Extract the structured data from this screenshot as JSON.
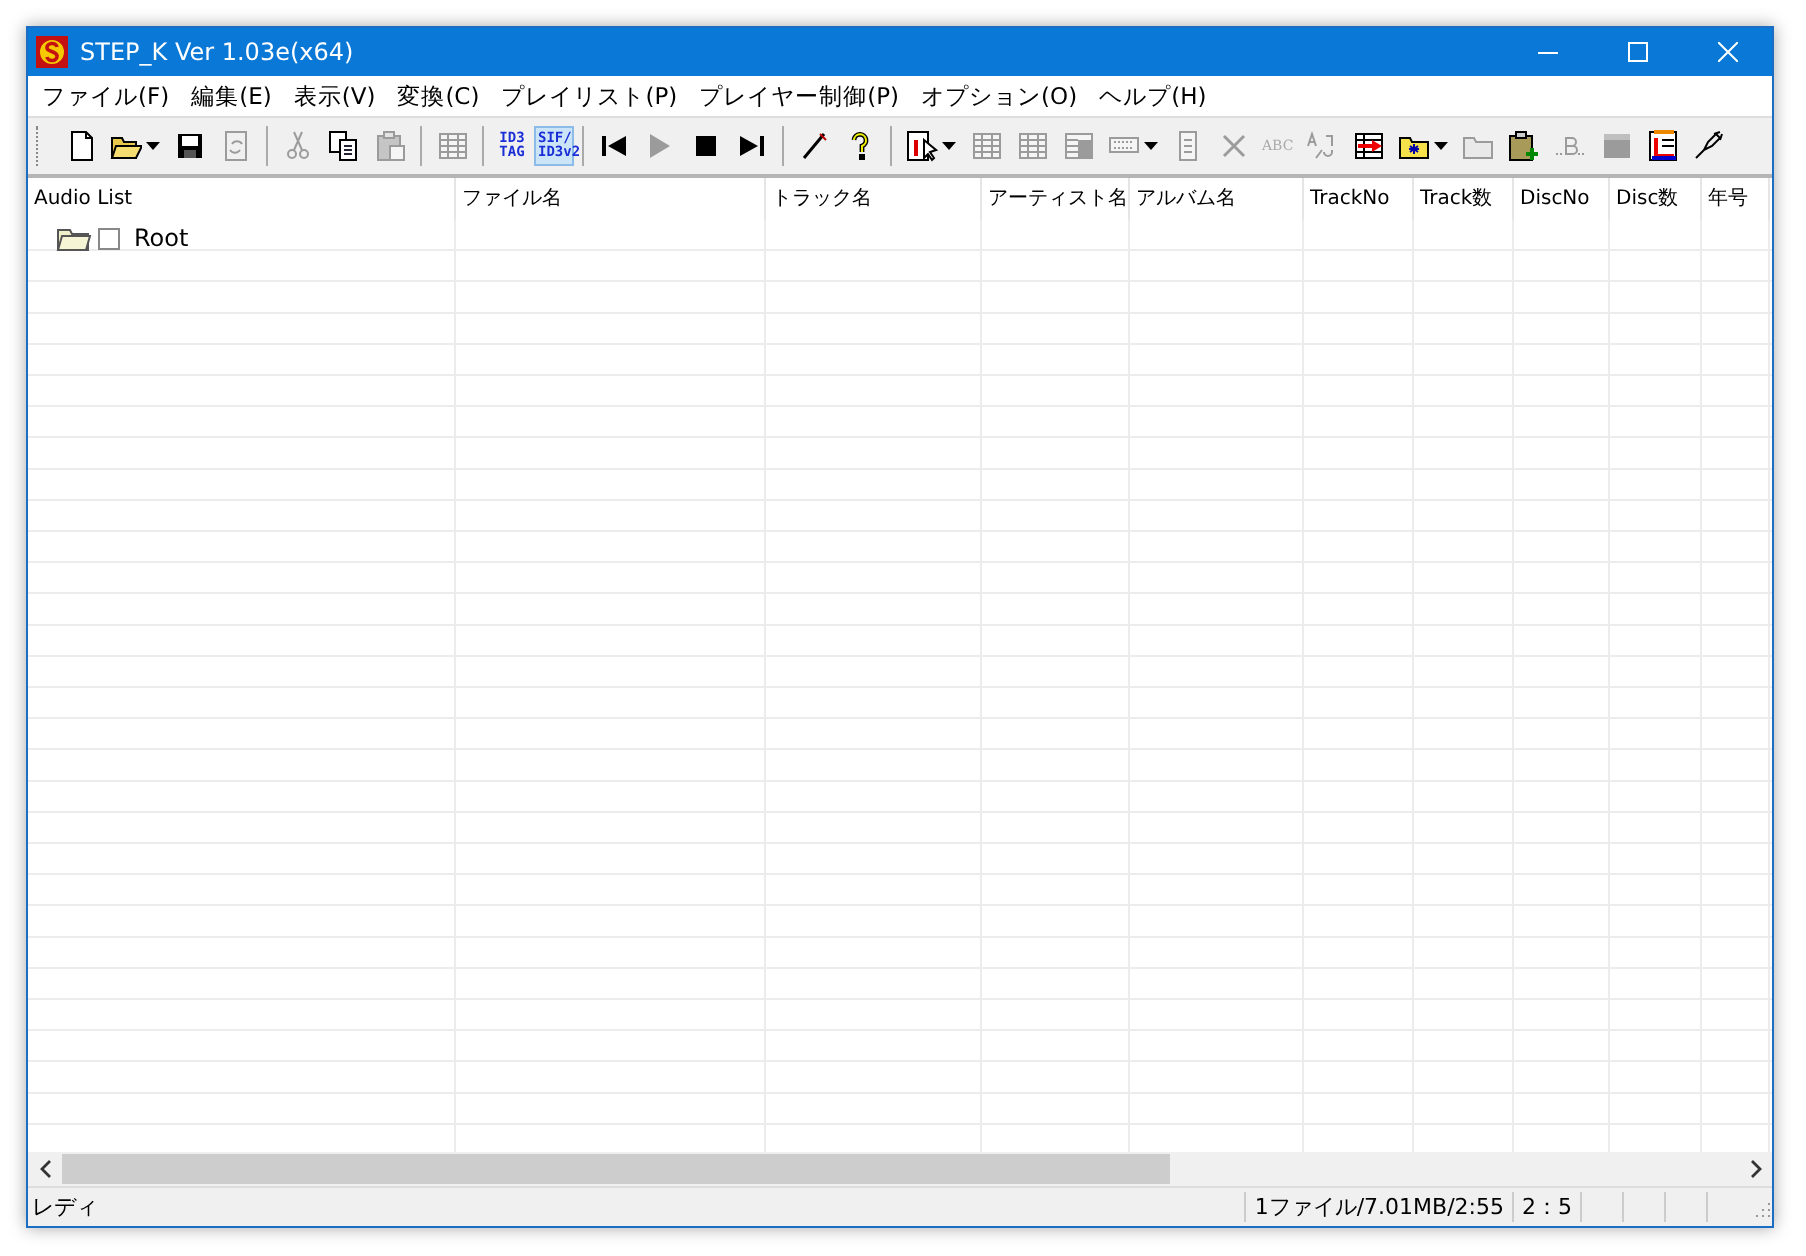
{
  "window": {
    "title": "STEP_K Ver 1.03e(x64)"
  },
  "menu": [
    "ファイル(F)",
    "編集(E)",
    "表示(V)",
    "変換(C)",
    "プレイリスト(P)",
    "プレイヤー制御(P)",
    "オプション(O)",
    "ヘルプ(H)"
  ],
  "toolbar": [
    {
      "kind": "icon",
      "disabled": false,
      "dropdown": false
    },
    {
      "kind": "icon",
      "disabled": false,
      "dropdown": true
    },
    {
      "kind": "icon",
      "disabled": false,
      "dropdown": false
    },
    {
      "kind": "icon",
      "disabled": true,
      "dropdown": false
    },
    {
      "kind": "separator"
    },
    {
      "kind": "icon",
      "disabled": true,
      "dropdown": false
    },
    {
      "kind": "icon",
      "disabled": false,
      "dropdown": false
    },
    {
      "kind": "icon",
      "disabled": true,
      "dropdown": false
    },
    {
      "kind": "separator"
    },
    {
      "kind": "icon",
      "disabled": true,
      "dropdown": false
    },
    {
      "kind": "separator"
    },
    {
      "kind": "text",
      "label": "ID3 TAG",
      "selected": false
    },
    {
      "kind": "text",
      "label": "SIF/ ID3v2",
      "selected": true
    },
    {
      "kind": "separator"
    },
    {
      "kind": "icon",
      "disabled": false,
      "dropdown": false
    },
    {
      "kind": "icon",
      "disabled": true,
      "dropdown": false
    },
    {
      "kind": "icon",
      "disabled": false,
      "dropdown": false
    },
    {
      "kind": "icon",
      "disabled": false,
      "dropdown": false
    },
    {
      "kind": "separator"
    },
    {
      "kind": "icon",
      "disabled": false,
      "dropdown": false
    },
    {
      "kind": "icon",
      "disabled": false,
      "dropdown": false
    },
    {
      "kind": "separator"
    },
    {
      "kind": "icon",
      "disabled": false,
      "dropdown": true
    },
    {
      "kind": "icon",
      "disabled": true,
      "dropdown": false
    },
    {
      "kind": "icon",
      "disabled": true,
      "dropdown": false
    },
    {
      "kind": "icon",
      "disabled": true,
      "dropdown": false
    },
    {
      "kind": "icon",
      "disabled": true,
      "dropdown": true
    },
    {
      "kind": "icon",
      "disabled": true,
      "dropdown": false
    },
    {
      "kind": "icon",
      "disabled": true,
      "dropdown": false
    },
    {
      "kind": "text",
      "label": "ABC",
      "selected": false,
      "disabled": true
    },
    {
      "kind": "icon",
      "disabled": true,
      "dropdown": false
    },
    {
      "kind": "icon",
      "disabled": false,
      "dropdown": false
    },
    {
      "kind": "icon",
      "disabled": false,
      "dropdown": true
    },
    {
      "kind": "icon",
      "disabled": true,
      "dropdown": false
    },
    {
      "kind": "icon",
      "disabled": false,
      "dropdown": false
    },
    {
      "kind": "icon",
      "disabled": true,
      "dropdown": false
    },
    {
      "kind": "icon",
      "disabled": true,
      "dropdown": false
    },
    {
      "kind": "icon",
      "disabled": false,
      "dropdown": false
    },
    {
      "kind": "icon",
      "disabled": false,
      "dropdown": false
    }
  ],
  "table": {
    "columns": [
      "Audio List",
      "ファイル名",
      "トラック名",
      "アーティスト名",
      "アルバム名",
      "TrackNo",
      "Track数",
      "DiscNo",
      "Disc数",
      "年号"
    ],
    "tree": [
      {
        "label": "Root",
        "checked": false
      }
    ]
  },
  "status_bar": {
    "message": "レディ",
    "panes": [
      "1ファイル/7.01MB/2:55",
      "2：5"
    ]
  }
}
